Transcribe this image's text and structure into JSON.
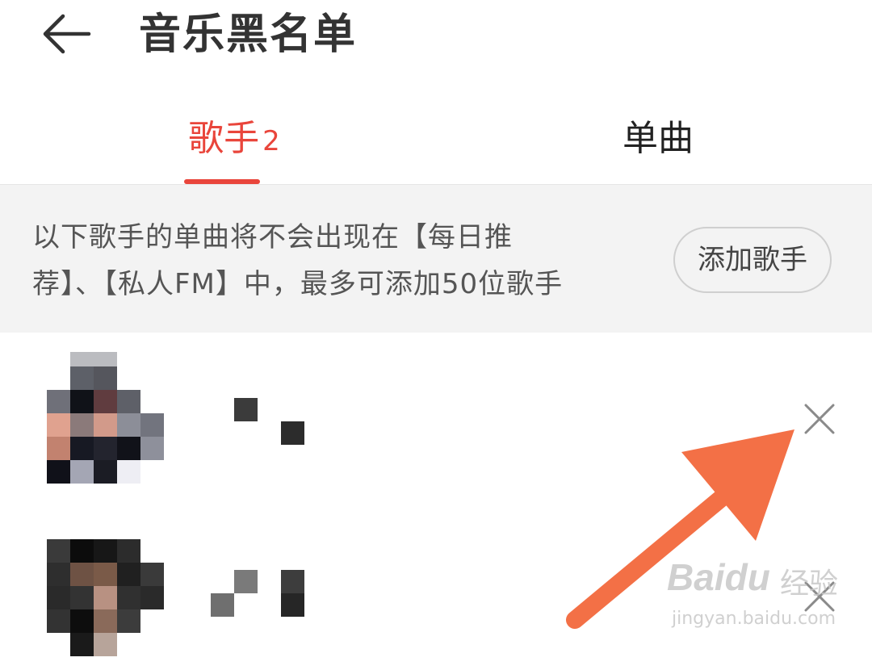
{
  "header": {
    "title": "音乐黑名单",
    "back_icon": "arrow-left-icon"
  },
  "tabs": [
    {
      "label": "歌手",
      "count": "2",
      "active": true
    },
    {
      "label": "单曲",
      "active": false
    }
  ],
  "notice": {
    "line1": "以下歌手的单曲将不会出现在【每日推",
    "line2": "荐】、【私人FM】中，最多可添加50位歌手",
    "add_button": "添加歌手"
  },
  "colors": {
    "accent": "#e9453b",
    "notice_bg": "#f3f3f3",
    "arrow": "#f37046"
  },
  "watermark": {
    "brand": "Bai",
    "brand2": "du",
    "text": "经验",
    "url": "jingyan.baidu.com"
  }
}
